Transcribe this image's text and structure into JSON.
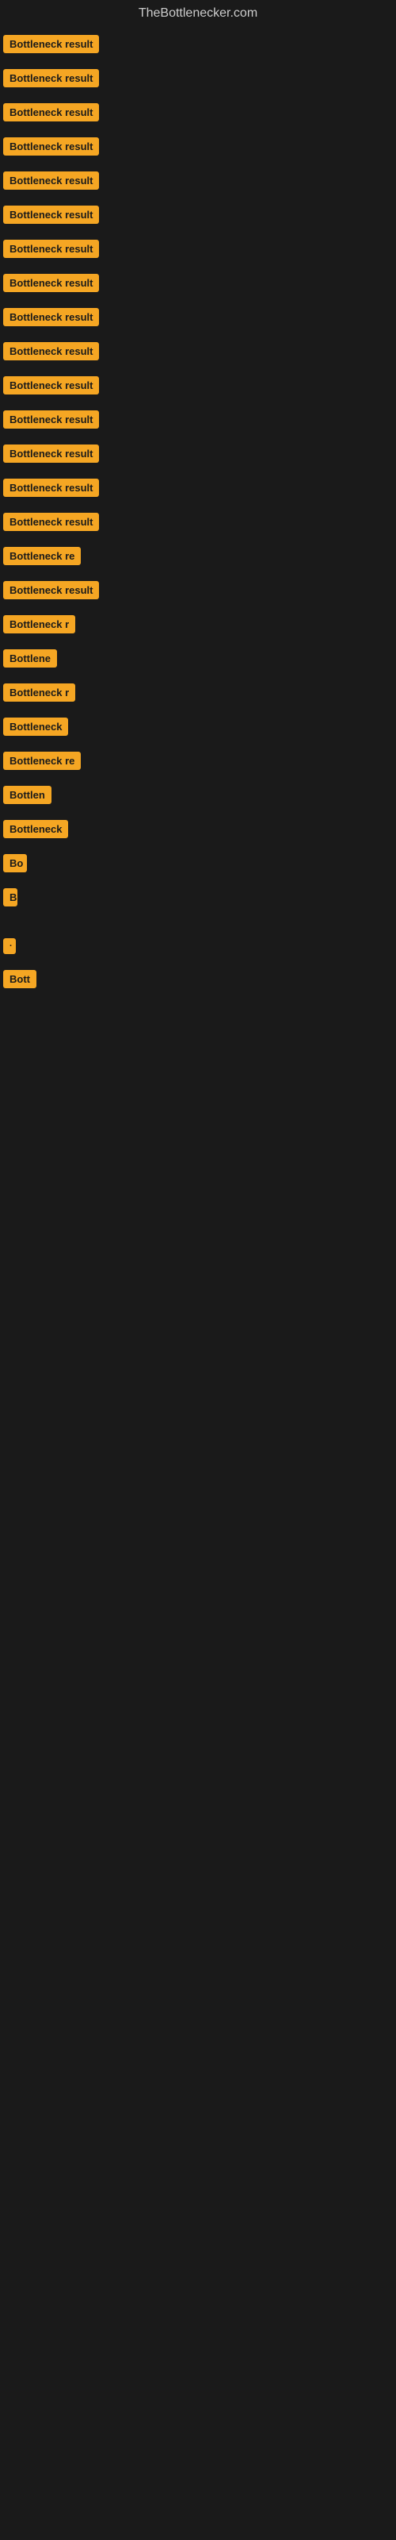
{
  "site": {
    "title": "TheBottlenecker.com"
  },
  "rows": [
    {
      "label": "Bottleneck result",
      "width": 130
    },
    {
      "label": "Bottleneck result",
      "width": 130
    },
    {
      "label": "Bottleneck result",
      "width": 130
    },
    {
      "label": "Bottleneck result",
      "width": 130
    },
    {
      "label": "Bottleneck result",
      "width": 130
    },
    {
      "label": "Bottleneck result",
      "width": 130
    },
    {
      "label": "Bottleneck result",
      "width": 130
    },
    {
      "label": "Bottleneck result",
      "width": 130
    },
    {
      "label": "Bottleneck result",
      "width": 130
    },
    {
      "label": "Bottleneck result",
      "width": 130
    },
    {
      "label": "Bottleneck result",
      "width": 130
    },
    {
      "label": "Bottleneck result",
      "width": 130
    },
    {
      "label": "Bottleneck result",
      "width": 130
    },
    {
      "label": "Bottleneck result",
      "width": 130
    },
    {
      "label": "Bottleneck result",
      "width": 130
    },
    {
      "label": "Bottleneck re",
      "width": 110
    },
    {
      "label": "Bottleneck result",
      "width": 130
    },
    {
      "label": "Bottleneck r",
      "width": 100
    },
    {
      "label": "Bottlene",
      "width": 80
    },
    {
      "label": "Bottleneck r",
      "width": 100
    },
    {
      "label": "Bottleneck",
      "width": 90
    },
    {
      "label": "Bottleneck re",
      "width": 105
    },
    {
      "label": "Bottlen",
      "width": 72
    },
    {
      "label": "Bottleneck",
      "width": 88
    },
    {
      "label": "Bo",
      "width": 30
    },
    {
      "label": "B",
      "width": 18
    },
    {
      "label": "",
      "width": 0
    },
    {
      "label": "·",
      "width": 10
    },
    {
      "label": "Bott",
      "width": 45
    },
    {
      "label": "",
      "width": 0
    },
    {
      "label": "",
      "width": 0
    },
    {
      "label": "",
      "width": 0
    },
    {
      "label": "",
      "width": 0
    },
    {
      "label": "",
      "width": 0
    }
  ]
}
